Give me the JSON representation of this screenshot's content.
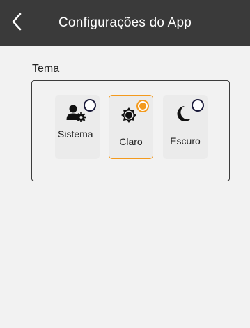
{
  "header": {
    "title": "Configurações do App",
    "back_icon": "chevron-left-icon",
    "background": "#3a3a3a"
  },
  "theme": {
    "label": "Tema",
    "selected": "Claro",
    "accent": "#f39a1e",
    "options": [
      {
        "label": "Sistema",
        "icon": "user-gear-icon",
        "selected": false
      },
      {
        "label": "Claro",
        "icon": "sun-gear-icon",
        "selected": true
      },
      {
        "label": "Escuro",
        "icon": "moon-icon",
        "selected": false
      }
    ]
  }
}
